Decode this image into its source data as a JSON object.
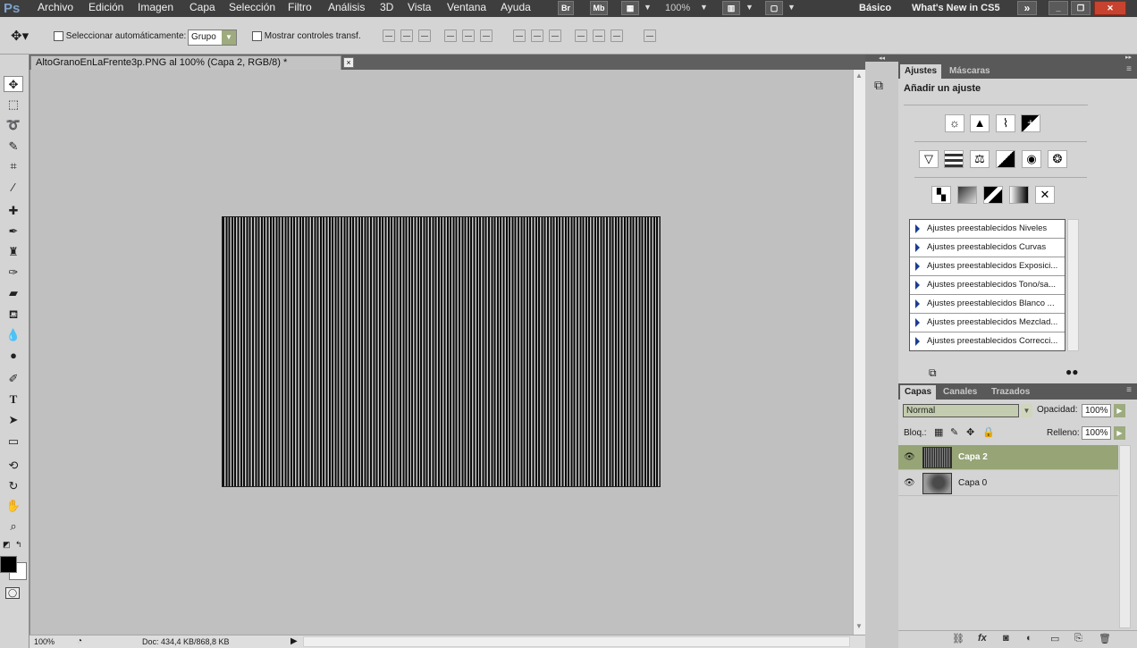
{
  "app": {
    "logo": "Ps"
  },
  "menu": [
    "Archivo",
    "Edición",
    "Imagen",
    "Capa",
    "Selección",
    "Filtro",
    "Análisis",
    "3D",
    "Vista",
    "Ventana",
    "Ayuda"
  ],
  "appbar": {
    "br": "Br",
    "mb": "Mb",
    "zoom": "100%",
    "workspace": "Básico",
    "whats_new": "What's New in CS5"
  },
  "options": {
    "auto_select_label": "Seleccionar automáticamente:",
    "group_value": "Grupo",
    "transform_label": "Mostrar controles transf."
  },
  "document": {
    "tab_title": "AltoGranoEnLaFrente3p.PNG al 100% (Capa 2, RGB/8) *",
    "close": "×"
  },
  "status": {
    "zoom": "100%",
    "doc": "Doc: 434,4 KB/868,8 KB"
  },
  "adjust_panel": {
    "tabs": [
      "Ajustes",
      "Máscaras"
    ],
    "heading": "Añadir un ajuste",
    "presets": [
      "Ajustes preestablecidos Niveles",
      "Ajustes preestablecidos Curvas",
      "Ajustes preestablecidos Exposici...",
      "Ajustes preestablecidos Tono/sa...",
      "Ajustes preestablecidos Blanco ...",
      "Ajustes preestablecidos Mezclad...",
      "Ajustes preestablecidos Correcci..."
    ]
  },
  "layers_panel": {
    "tabs": [
      "Capas",
      "Canales",
      "Trazados"
    ],
    "blend_mode": "Normal",
    "opacity_label": "Opacidad:",
    "opacity": "100%",
    "lock_label": "Bloq.:",
    "fill_label": "Relleno:",
    "fill": "100%",
    "layers": [
      {
        "name": "Capa 2",
        "selected": true
      },
      {
        "name": "Capa 0",
        "selected": false
      }
    ]
  },
  "colors": {
    "accent": "#8a9a6a",
    "selected_layer": "#96a476",
    "menubar": "#3e3e3e",
    "canvas_bg": "#c0c0c0"
  }
}
